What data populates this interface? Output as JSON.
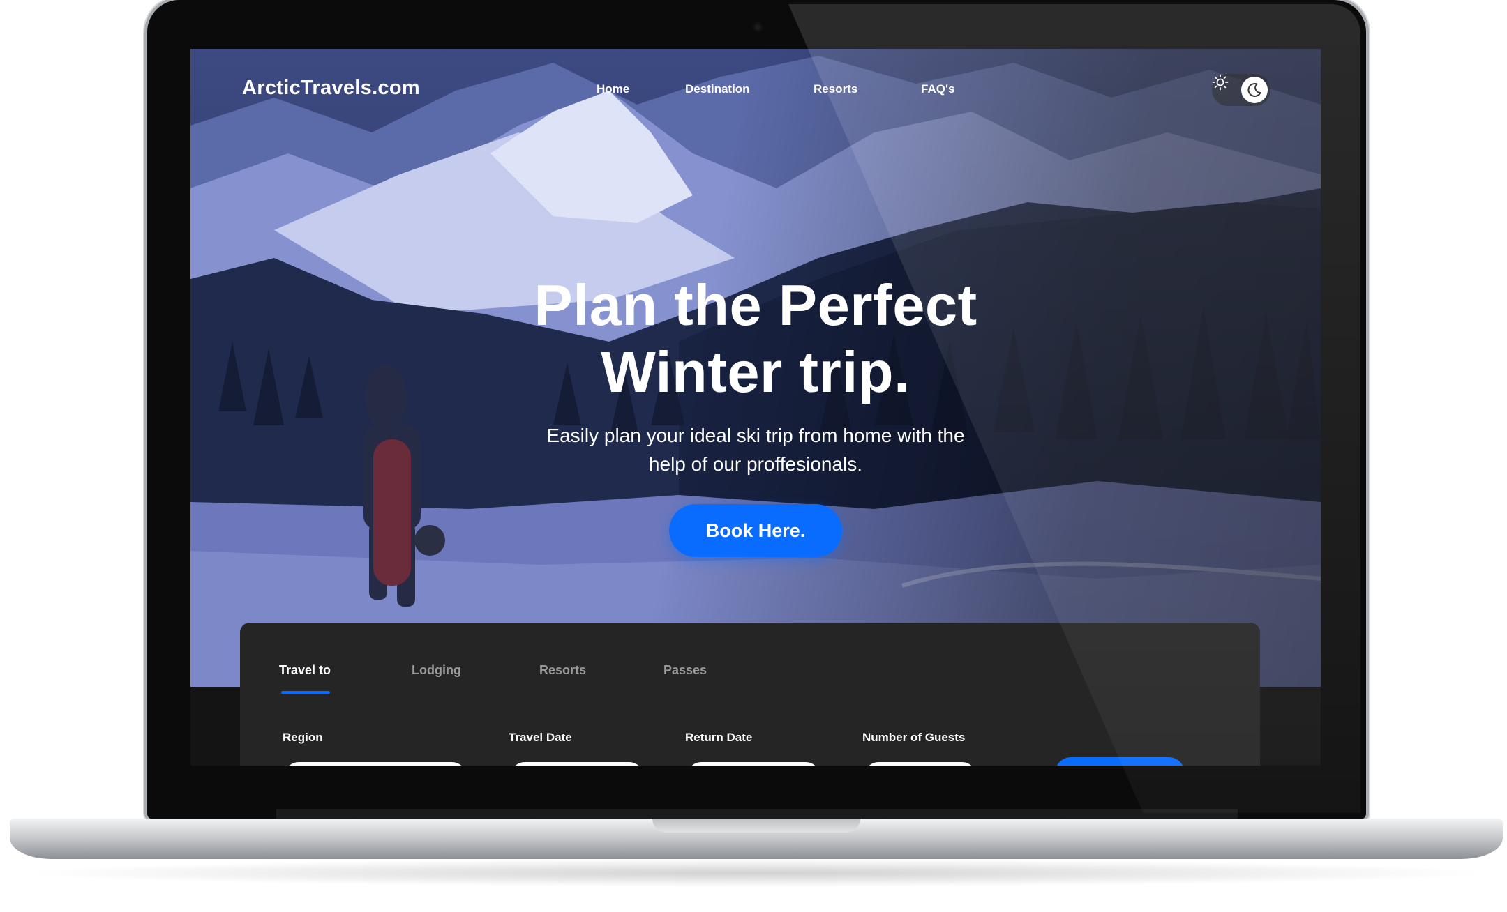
{
  "site": {
    "logo": "ArcticTravels.com",
    "nav": [
      "Home",
      "Destination",
      "Resorts",
      "FAQ's"
    ]
  },
  "hero": {
    "headline_line1": "Plan the Perfect",
    "headline_line2": "Winter trip.",
    "subtitle_line1": "Easily plan your ideal ski trip from home with the",
    "subtitle_line2": "help of our proffesionals.",
    "cta": "Book Here."
  },
  "theme_toggle": {
    "icons": [
      "sun-icon",
      "moon-icon"
    ],
    "selected": "dark"
  },
  "booking": {
    "tabs": [
      "Travel to",
      "Lodging",
      "Resorts",
      "Passes"
    ],
    "active_tab": "Travel to",
    "fields": [
      "Region",
      "Travel Date",
      "Return Date",
      "Number of Guests"
    ]
  },
  "colors": {
    "accent": "#0a6cff",
    "panel": "#252526",
    "text": "#ffffff",
    "muted": "#9a9a9a"
  }
}
